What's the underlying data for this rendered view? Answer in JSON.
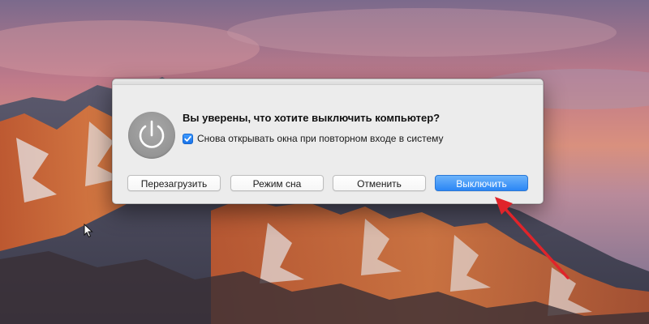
{
  "dialog": {
    "title": "Вы уверены, что хотите выключить компьютер?",
    "checkbox": {
      "label": "Снова открывать окна при повторном входе в систему",
      "checked": true
    },
    "buttons": {
      "restart_label": "Перезагрузить",
      "sleep_label": "Режим сна",
      "cancel_label": "Отменить",
      "shutdown_label": "Выключить"
    },
    "icon": "power-icon",
    "default_button": "shutdown"
  },
  "annotation": {
    "type": "arrow",
    "color": "#e0242a",
    "points_to": "shutdown-button"
  },
  "colors": {
    "accent": "#2b86f5",
    "dialog_background": "#ececec",
    "power_icon_background": "#999999"
  }
}
